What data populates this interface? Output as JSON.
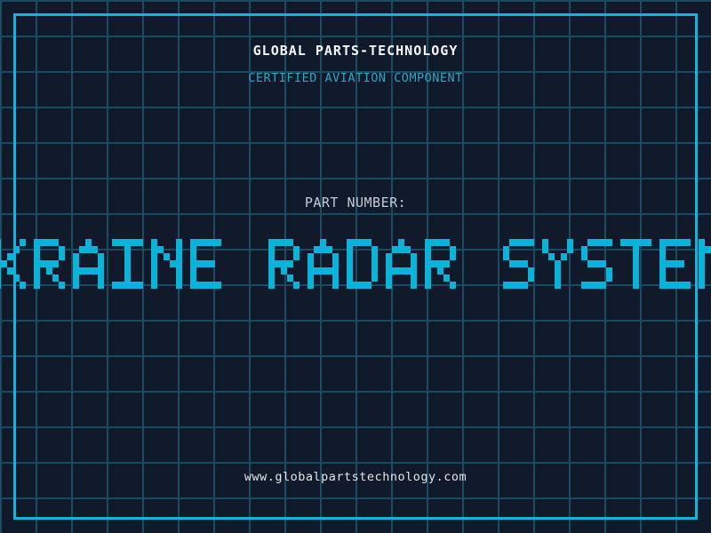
{
  "header": {
    "title": "GLOBAL PARTS-TECHNOLOGY",
    "subtitle": "CERTIFIED AVIATION COMPONENT"
  },
  "part_number": {
    "label": "PART NUMBER:",
    "value": "UKRAINE RADAR SYSTEM"
  },
  "footer": {
    "url": "www.globalpartstechnology.com"
  },
  "colors": {
    "background": "#101a2a",
    "grid_line": "#1b4a61",
    "frame": "#0fb5dd",
    "pixel_text": "#0ab3da",
    "title_text": "#f5f7f9",
    "subtitle_text": "#2ba6c9",
    "label_text": "#c6cbd5",
    "url_text": "#e2e5e9"
  }
}
